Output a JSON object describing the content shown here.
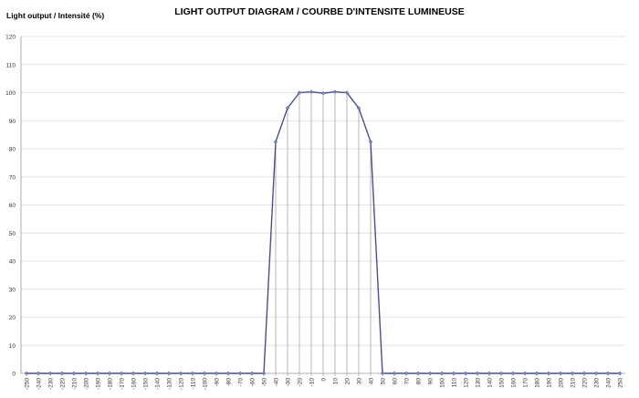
{
  "chart_data": {
    "type": "line",
    "title": "LIGHT OUTPUT DIAGRAM / COURBE D'INTENSITE LUMINEUSE",
    "ylabel": "Light output / Intensité (%)",
    "xlabel": "",
    "ylim": [
      0,
      120
    ],
    "y_ticks": [
      0,
      10,
      20,
      30,
      40,
      50,
      60,
      70,
      80,
      90,
      100,
      110,
      120
    ],
    "xlim": [
      -250,
      250
    ],
    "x": [
      -250,
      -240,
      -230,
      -220,
      -210,
      -200,
      -190,
      -180,
      -170,
      -160,
      -150,
      -140,
      -130,
      -120,
      -110,
      -100,
      -90,
      -80,
      -70,
      -60,
      -50,
      -40,
      -30,
      -20,
      -10,
      0,
      10,
      20,
      30,
      40,
      50,
      60,
      70,
      80,
      90,
      100,
      110,
      120,
      130,
      140,
      150,
      160,
      170,
      180,
      190,
      200,
      210,
      220,
      230,
      240,
      250
    ],
    "series": [
      {
        "values": [
          0,
          0,
          0,
          0,
          0,
          0,
          0,
          0,
          0,
          0,
          0,
          0,
          0,
          0,
          0,
          0,
          0,
          0,
          0,
          0,
          0,
          82.5,
          94.5,
          100,
          100.3,
          99.8,
          100.3,
          100,
          94.5,
          82.5,
          0,
          0,
          0,
          0,
          0,
          0,
          0,
          0,
          0,
          0,
          0,
          0,
          0,
          0,
          0,
          0,
          0,
          0,
          0,
          0,
          0
        ],
        "color": "#4a4f8c",
        "marker_color": "#6f86c8"
      }
    ],
    "grid": "horizontal",
    "drop_lines_from_nonzero_points": true
  }
}
